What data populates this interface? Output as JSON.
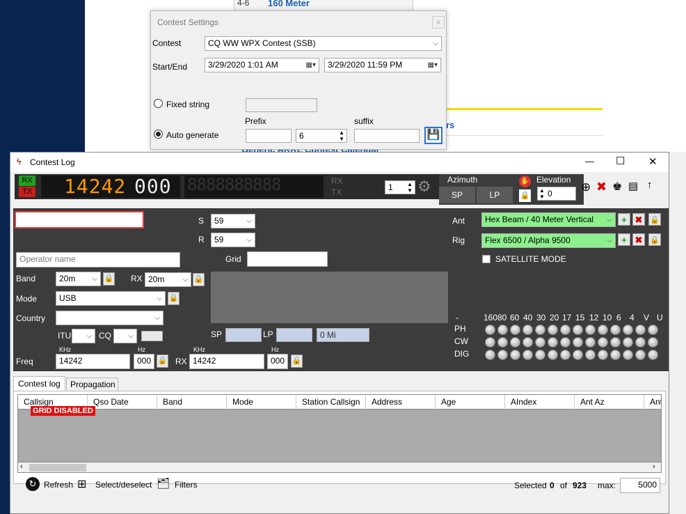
{
  "background": {
    "band_col": "4-6",
    "band_title": "160 Meter",
    "link_fragment": "rs",
    "link_text": "Generic ARRL Contest Calendar"
  },
  "settings": {
    "title": "Contest Settings",
    "contest_label": "Contest",
    "contest_value": "CQ WW WPX Contest (SSB)",
    "startend_label": "Start/End",
    "start_value": "3/29/2020  1:01 AM",
    "end_value": "3/29/2020 11:59 PM",
    "fixed_label": "Fixed string",
    "auto_label": "Auto generate",
    "prefix_label": "Prefix",
    "suffix_label": "suffix",
    "serial_value": "6",
    "close": "×"
  },
  "window": {
    "title": "Contest Log",
    "min": "—",
    "max": "☐",
    "close": "✕"
  },
  "toolbar": {
    "rx": "RX",
    "tx": "TX",
    "freq_main": "14242",
    "freq_frac": "000",
    "freq_ghost": "8888888888",
    "rx2": "RX",
    "tx2": "TX",
    "vfo_value": "1",
    "azimuth_label": "Azimuth",
    "sp": "SP",
    "lp": "LP",
    "elevation_label": "Elevation",
    "elevation_value": "0"
  },
  "form": {
    "s_label": "S",
    "s_value": "59",
    "r_label": "R",
    "r_value": "59",
    "operator_placeholder": "Operator name",
    "grid_label": "Grid",
    "band_label": "Band",
    "band_value": "20m",
    "rx_label": "RX",
    "rx_band_value": "20m",
    "mode_label": "Mode",
    "mode_value": "USB",
    "country_label": "Country",
    "itu_label": "ITU",
    "cq_label": "CQ",
    "sp_label": "SP",
    "lp_label": "LP",
    "distance_value": "0 Mi",
    "khz": "KHz",
    "hz": "Hz",
    "freq_label": "Freq",
    "freq_khz": "14242",
    "freq_hz": "000",
    "rx_freq_label": "RX",
    "rx_freq_khz": "14242",
    "rx_freq_hz": "000",
    "ant_label": "Ant",
    "ant_value": "Hex Beam / 40 Meter Vertical",
    "rig_label": "Rig",
    "rig_value": "Flex 6500 / Alpha 9500",
    "satellite_label": "SATELLITE MODE",
    "band_dash": "-",
    "bands": [
      "160",
      "80",
      "60",
      "40",
      "30",
      "20",
      "17",
      "15",
      "12",
      "10",
      "6",
      "4",
      "V",
      "U"
    ],
    "modes": [
      "PH",
      "CW",
      "DIG"
    ]
  },
  "tabs": [
    "Contest log",
    "Propagation"
  ],
  "grid": {
    "columns": [
      "Callsign",
      "Qso Date",
      "Band",
      "Mode",
      "Station Callsign",
      "Address",
      "Age",
      "AIndex",
      "Ant Az",
      "Ant"
    ],
    "disabled_badge": "GRID DISABLED"
  },
  "footer": {
    "refresh": "Refresh",
    "select": "Select/deselect",
    "filters": "Filters",
    "selected_label": "Selected",
    "selected_count": "0",
    "of_label": "of",
    "total": "923",
    "max_label": "max:",
    "max_value": "5000"
  },
  "colors": {
    "dark_panel": "#3c3c3c",
    "led_green": "#1fa31f",
    "led_red": "#c81e1e",
    "freq_orange": "#ff9a00",
    "ant_green": "#8cf08c",
    "badge_red": "#e01010"
  }
}
